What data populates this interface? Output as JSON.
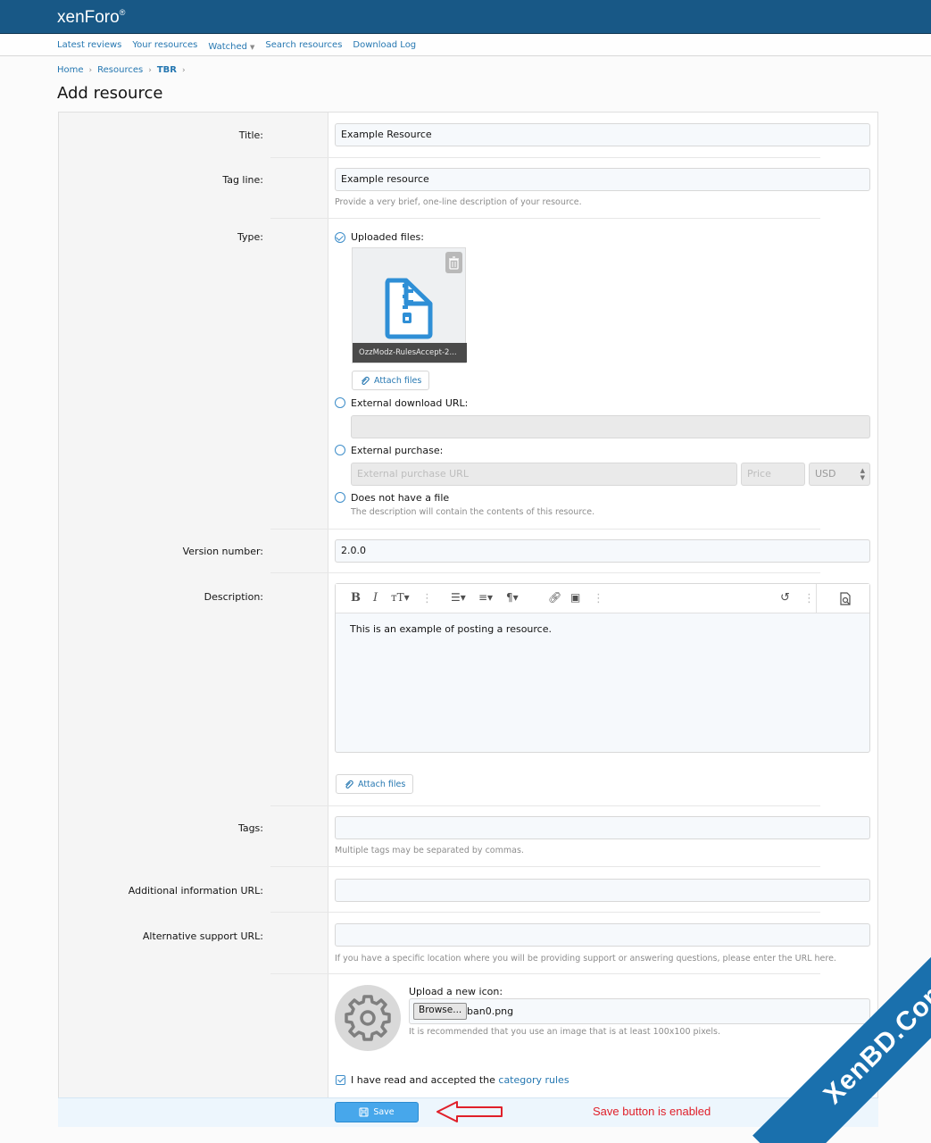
{
  "header": {
    "logo": "xenForo",
    "logo_mark": "®"
  },
  "subnav": [
    {
      "label": "Latest reviews"
    },
    {
      "label": "Your resources"
    },
    {
      "label": "Watched"
    },
    {
      "label": "Search resources"
    },
    {
      "label": "Download Log"
    }
  ],
  "breadcrumb": [
    "Home",
    "Resources",
    "TBR"
  ],
  "page_title": "Add resource",
  "form": {
    "title": {
      "label": "Title:",
      "value": "Example Resource"
    },
    "tagline": {
      "label": "Tag line:",
      "value": "Example resource",
      "hint": "Provide a very brief, one-line description of your resource."
    },
    "type": {
      "label": "Type:",
      "uploaded": {
        "label": "Uploaded files:",
        "file_name": "OzzModz-RulesAccept-2...",
        "attach_label": "Attach files"
      },
      "external_url": {
        "label": "External download URL:"
      },
      "external_purchase": {
        "label": "External purchase:",
        "url_placeholder": "External purchase URL",
        "price_placeholder": "Price",
        "currency": "USD"
      },
      "no_file": {
        "label": "Does not have a file",
        "hint": "The description will contain the contents of this resource."
      }
    },
    "version": {
      "label": "Version number:",
      "value": "2.0.0"
    },
    "description": {
      "label": "Description:",
      "body": "This is an example of posting a resource.",
      "attach_label": "Attach files"
    },
    "tags": {
      "label": "Tags:",
      "hint": "Multiple tags may be separated by commas."
    },
    "info_url": {
      "label": "Additional information URL:"
    },
    "support_url": {
      "label": "Alternative support URL:",
      "hint": "If you have a specific location where you will be providing support or answering questions, please enter the URL here."
    },
    "icon": {
      "label": "Upload a new icon:",
      "browse": "Browse...",
      "file": "ban0.png",
      "hint": "It is recommended that you use an image that is at least 100x100 pixels."
    },
    "rules": {
      "prefix": "I have read and accepted the ",
      "link": "category rules"
    },
    "save_label": "Save"
  },
  "annotation": "Save button is enabled",
  "watermark": "XenBD.Com",
  "colors": {
    "header": "#185886",
    "accent": "#2577b1",
    "save": "#47a7eb",
    "annotation": "#e0202a"
  }
}
